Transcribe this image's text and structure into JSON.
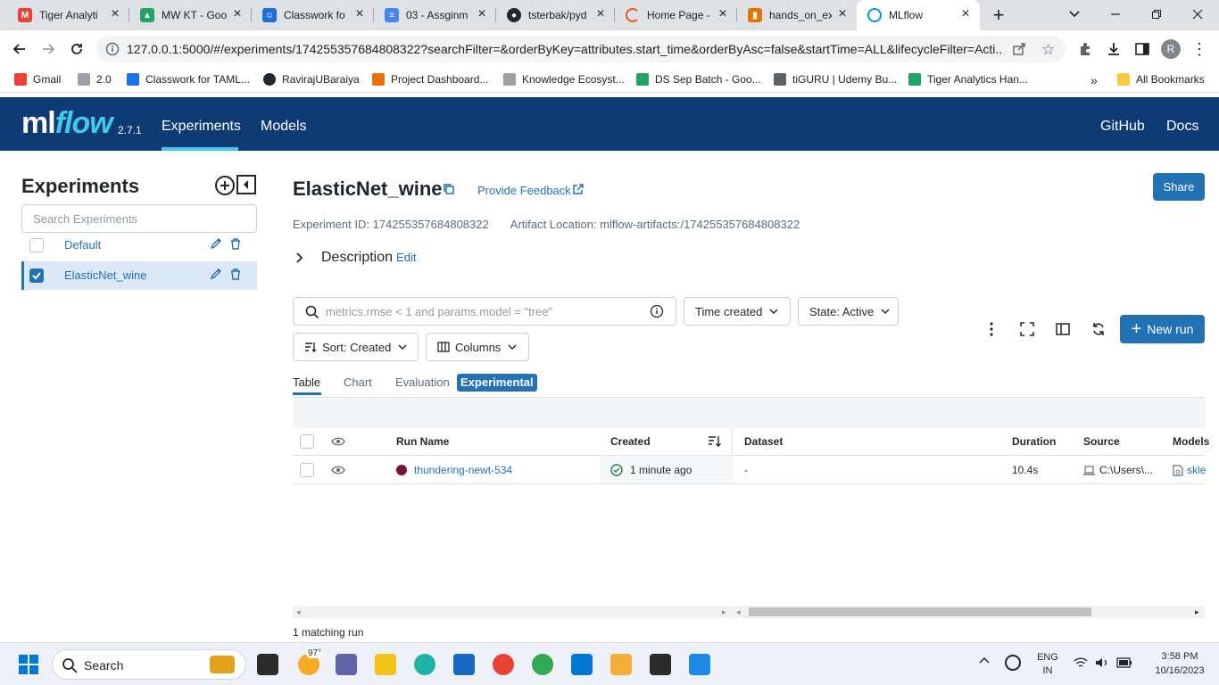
{
  "browser": {
    "tabs": [
      {
        "title": "Tiger Analyti",
        "icon": "gmail-icon",
        "color": "#ea4335"
      },
      {
        "title": "MW KT - Goo",
        "icon": "google-drive-icon",
        "color": "#1fa463"
      },
      {
        "title": "Classwork fo",
        "icon": "google-classroom-icon",
        "color": "#1e8e3e"
      },
      {
        "title": "03 - Assginm",
        "icon": "google-docs-icon",
        "color": "#4285f4"
      },
      {
        "title": "tsterbak/pyd",
        "icon": "github-icon",
        "color": "#24292f"
      },
      {
        "title": "Home Page -",
        "icon": "page-spinner-icon",
        "color": "#f4511e"
      },
      {
        "title": "hands_on_ex",
        "icon": "book-icon",
        "color": "#e37400"
      },
      {
        "title": "MLflow",
        "icon": "mlflow-icon",
        "color": "#0194e2"
      }
    ],
    "url": "127.0.0.1:5000/#/experiments/174255357684808322?searchFilter=&orderByKey=attributes.start_time&orderByAsc=false&startTime=ALL&lifecycleFilter=Acti...",
    "profile_initial": "R",
    "bookmarks": [
      {
        "label": "Gmail",
        "color": "#ea4335"
      },
      {
        "label": "2.0",
        "color": "#9aa0a6"
      },
      {
        "label": "Classwork for TAML...",
        "color": "#1a73e8"
      },
      {
        "label": "RavirajUBaraiya",
        "color": "#24292f"
      },
      {
        "label": "Project Dashboard...",
        "color": "#e8710a"
      },
      {
        "label": "Knowledge Ecosyst...",
        "color": "#9aa0a6"
      },
      {
        "label": "DS Sep Batch - Goo...",
        "color": "#1fa463"
      },
      {
        "label": "tiGURU | Udemy Bu...",
        "color": "#5f6368"
      },
      {
        "label": "Tiger Analytics Han...",
        "color": "#1fa463"
      }
    ],
    "more_bookmarks": "»",
    "all_bookmarks": "All Bookmarks"
  },
  "app": {
    "logo_ml": "ml",
    "logo_flow": "flow",
    "version": "2.7.1",
    "nav": {
      "experiments": "Experiments",
      "models": "Models",
      "github": "GitHub",
      "docs": "Docs"
    }
  },
  "sidebar": {
    "title": "Experiments",
    "search_placeholder": "Search Experiments",
    "items": [
      {
        "label": "Default",
        "checked": false
      },
      {
        "label": "ElasticNet_wine",
        "checked": true
      }
    ]
  },
  "experiment": {
    "name": "ElasticNet_wine",
    "feedback": "Provide Feedback",
    "share": "Share",
    "id_label": "Experiment ID: 174255357684808322",
    "artifact_label": "Artifact Location: mlflow-artifacts:/174255357684808322",
    "description": "Description",
    "edit": "Edit"
  },
  "runs": {
    "search_placeholder": "metrics.rmse < 1 and params.model = \"tree\"",
    "time_filter": "Time created",
    "state_filter": "State: Active",
    "sort": "Sort: Created",
    "columns": "Columns",
    "new_run": "New run",
    "view_tabs": {
      "table": "Table",
      "chart": "Chart",
      "evaluation": "Evaluation",
      "experimental": "Experimental"
    },
    "headers": {
      "run_name": "Run Name",
      "created": "Created",
      "dataset": "Dataset",
      "duration": "Duration",
      "source": "Source",
      "models": "Models"
    },
    "rows": [
      {
        "run_name": "thundering-newt-534",
        "run_color": "#7a1233",
        "created": "1 minute ago",
        "dataset": "-",
        "duration": "10.4s",
        "source": "C:\\Users\\...",
        "models": "skle"
      }
    ],
    "matching": "1 matching run"
  },
  "taskbar": {
    "search": "Search",
    "weather": "97°",
    "lang_1": "ENG",
    "lang_2": "IN",
    "time": "3:58 PM",
    "date": "10/16/2023"
  }
}
